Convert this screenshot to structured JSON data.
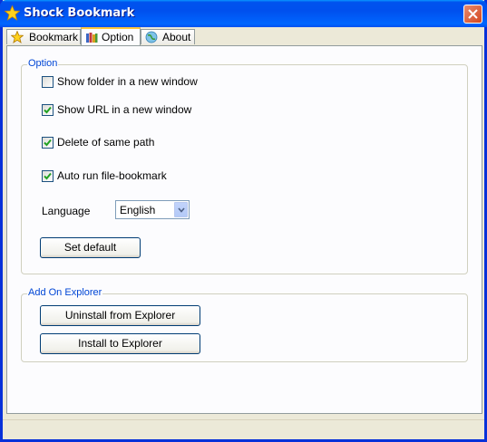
{
  "window": {
    "title": "Shock Bookmark"
  },
  "tabs": [
    {
      "label": "Bookmark",
      "icon": "star-icon"
    },
    {
      "label": "Option",
      "icon": "books-icon"
    },
    {
      "label": "About",
      "icon": "globe-person-icon"
    }
  ],
  "option_group": {
    "title": "Option",
    "checkboxes": [
      {
        "label": "Show folder in a new window",
        "checked": false
      },
      {
        "label": "Show URL in a new window",
        "checked": true
      },
      {
        "label": "Delete of same path",
        "checked": true
      },
      {
        "label": "Auto run file-bookmark",
        "checked": true
      }
    ],
    "language_label": "Language",
    "language_value": "English",
    "set_default_label": "Set default"
  },
  "explorer_group": {
    "title": "Add On Explorer",
    "uninstall_label": "Uninstall from Explorer",
    "install_label": "Install to Explorer"
  },
  "colors": {
    "titlebar": "#0054E3",
    "group_title": "#0046D5",
    "close": "#D4461E",
    "tab_highlight": "#FFC83C"
  }
}
